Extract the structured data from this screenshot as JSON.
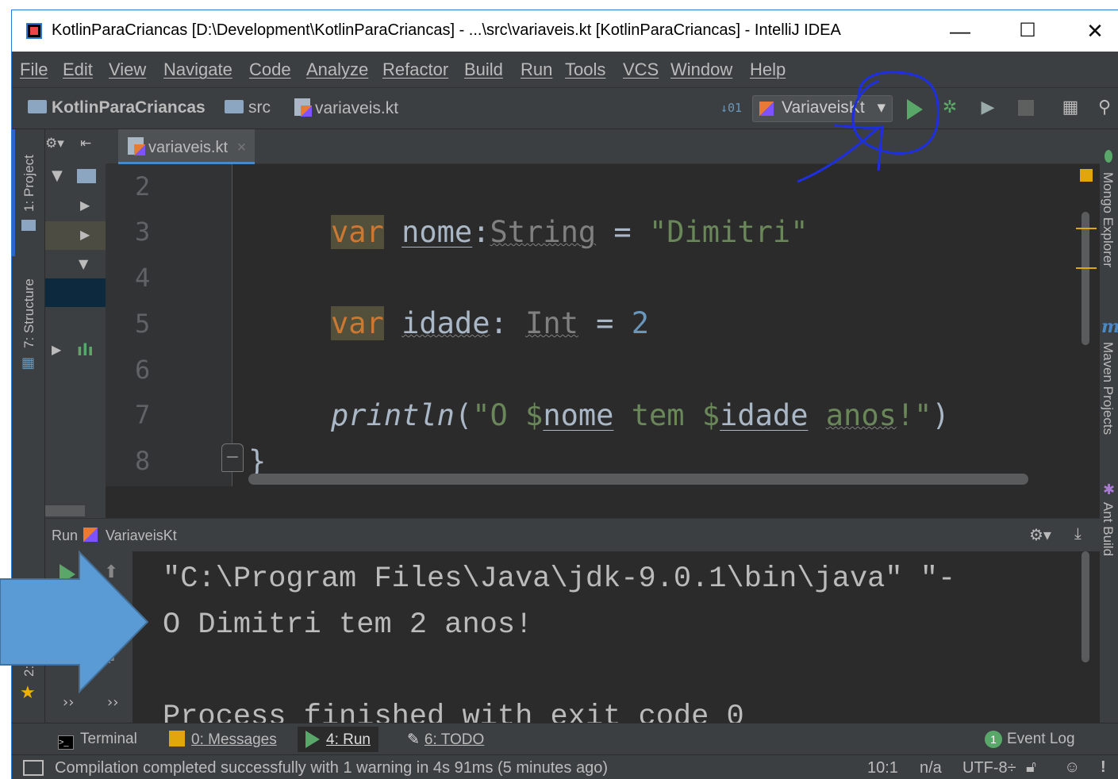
{
  "window": {
    "title": "KotlinParaCriancas [D:\\Development\\KotlinParaCriancas] - ...\\src\\variaveis.kt [KotlinParaCriancas] - IntelliJ IDEA",
    "minimize": "—",
    "maximize": "☐",
    "close": "✕"
  },
  "menu": [
    "File",
    "Edit",
    "View",
    "Navigate",
    "Code",
    "Analyze",
    "Refactor",
    "Build",
    "Run",
    "Tools",
    "VCS",
    "Window",
    "Help"
  ],
  "breadcrumb": {
    "project": "KotlinParaCriancas",
    "folder": "src",
    "file": "variaveis.kt"
  },
  "toolbar": {
    "run_config": "VariaveisKt",
    "dropdown_arrow": "▾"
  },
  "editor": {
    "tab_label": "variaveis.kt",
    "tab_close": "×",
    "line_numbers": [
      "2",
      "3",
      "4",
      "5",
      "6",
      "7",
      "8"
    ],
    "lines": {
      "l3_kw": "var",
      "l3_name": "nome",
      "l3_colon": ":",
      "l3_type": "String",
      "l3_eq": " = ",
      "l3_str": "\"Dimitri\"",
      "l5_kw": "var",
      "l5_name": "idade",
      "l5_colon": ": ",
      "l5_type": "Int",
      "l5_eq": " = ",
      "l5_num": "2",
      "l7_fn": "println",
      "l7_open": "(",
      "l7_s1": "\"O $",
      "l7_v1": "nome",
      "l7_s2": " tem $",
      "l7_v2": "idade",
      "l7_s3": " ",
      "l7_s4": "anos",
      "l7_s5": "!\"",
      "l7_close": ")",
      "l8_brace": "}"
    }
  },
  "left_tabs": {
    "project": "1: Project",
    "structure": "7: Structure",
    "favorites": "2: Favorites"
  },
  "right_tabs": {
    "mongo": "Mongo Explorer",
    "maven": "Maven Projects",
    "ant": "Ant Build"
  },
  "run_panel": {
    "label": "Run",
    "config": "VariaveisKt",
    "output": [
      "\"C:\\Program Files\\Java\\jdk-9.0.1\\bin\\java\" \"-",
      "O Dimitri tem 2 anos!",
      "",
      "Process finished with exit code 0"
    ]
  },
  "bottom_tabs": {
    "terminal": "Terminal",
    "messages": "0: Messages",
    "run": "4: Run",
    "todo": "6: TODO",
    "event_log": "Event Log",
    "event_count": "1"
  },
  "status": {
    "message": "Compilation completed successfully with 1 warning in 4s 91ms (5 minutes ago)",
    "position": "10:1",
    "na": "n/a",
    "encoding": "UTF-8÷"
  },
  "colors": {
    "accent_run": "#59a869",
    "annotation_blue": "#1d2fe0",
    "arrow_blue": "#5b9bd5"
  }
}
